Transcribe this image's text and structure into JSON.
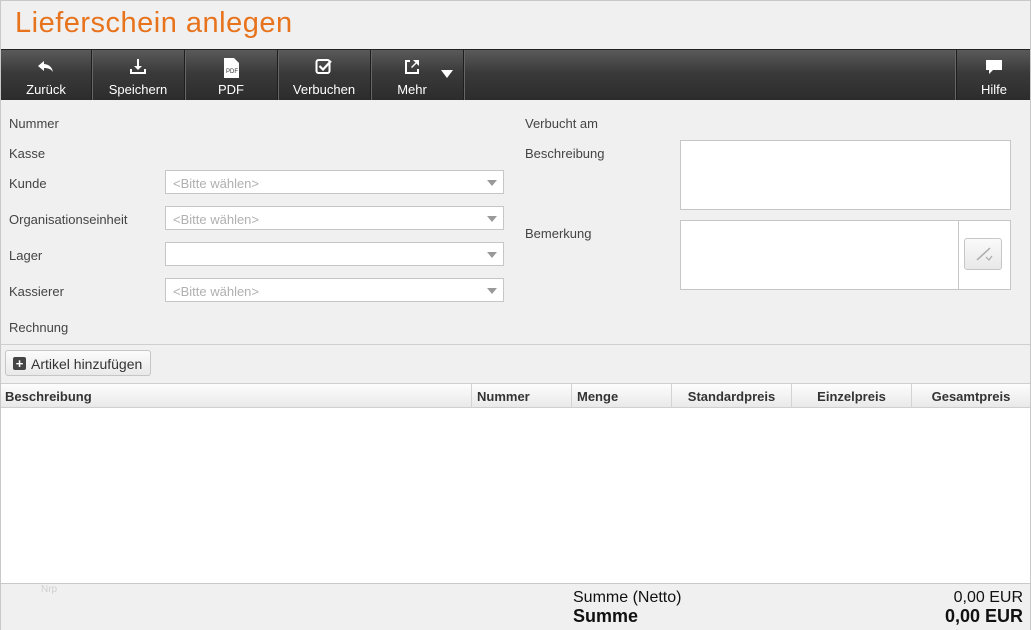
{
  "page": {
    "title": "Lieferschein anlegen"
  },
  "toolbar": {
    "back": "Zurück",
    "save": "Speichern",
    "pdf": "PDF",
    "book": "Verbuchen",
    "more": "Mehr",
    "help": "Hilfe"
  },
  "form": {
    "nummer_label": "Nummer",
    "kasse_label": "Kasse",
    "kunde_label": "Kunde",
    "kunde_placeholder": "<Bitte wählen>",
    "org_label": "Organisationseinheit",
    "org_placeholder": "<Bitte wählen>",
    "lager_label": "Lager",
    "lager_value": "",
    "kassierer_label": "Kassierer",
    "kassierer_placeholder": "<Bitte wählen>",
    "rechnung_label": "Rechnung",
    "verbucht_label": "Verbucht am",
    "beschreibung_label": "Beschreibung",
    "bemerkung_label": "Bemerkung"
  },
  "articles": {
    "add_label": "Artikel hinzufügen",
    "columns": [
      "Beschreibung",
      "Nummer",
      "Menge",
      "Standardpreis",
      "Einzelpreis",
      "Gesamtpreis"
    ],
    "rows": []
  },
  "footer": {
    "faint_text": "Nrp",
    "net_label": "Summe (Netto)",
    "net_value": "0,00 EUR",
    "total_label": "Summe",
    "total_value": "0,00 EUR"
  }
}
